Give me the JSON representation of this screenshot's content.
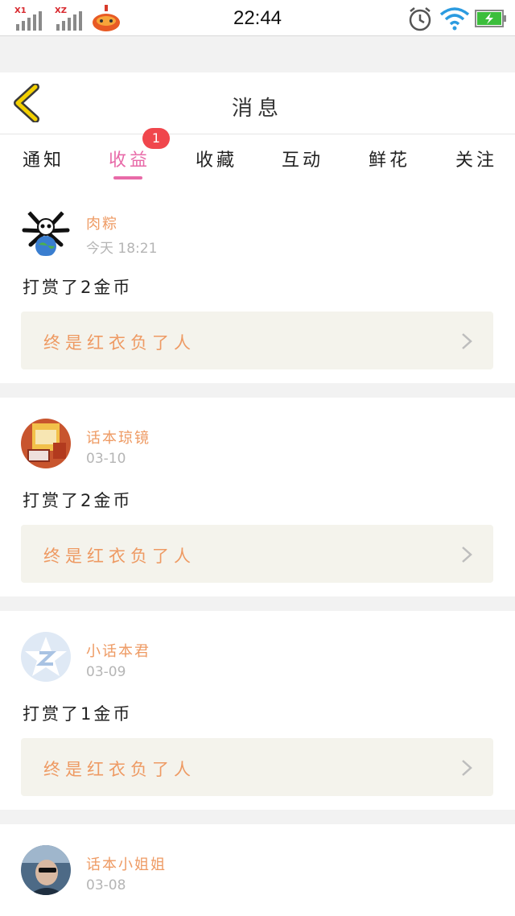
{
  "status_bar": {
    "sim1_label": "X1",
    "sim2_label": "XZ",
    "time": "22:44"
  },
  "nav": {
    "title": "消息",
    "back_icon": "chevron-left-icon",
    "accent": "#f0c800"
  },
  "tabs": {
    "items": [
      {
        "label": "通知"
      },
      {
        "label": "收益",
        "active": true,
        "badge": "1"
      },
      {
        "label": "收藏"
      },
      {
        "label": "互动"
      },
      {
        "label": "鲜花"
      },
      {
        "label": "关注"
      }
    ],
    "active_color": "#e86aa8",
    "badge_color": "#f0464c"
  },
  "feed": [
    {
      "user": "肉粽",
      "time": "今天 18:21",
      "message": "打赏了2金币",
      "work_title": "终是红衣负了人",
      "avatar": "panda-avatar"
    },
    {
      "user": "话本琼镜",
      "time": "03-10",
      "message": "打赏了2金币",
      "work_title": "终是红衣负了人",
      "avatar": "book-avatar"
    },
    {
      "user": "小话本君",
      "time": "03-09",
      "message": "打赏了1金币",
      "work_title": "终是红衣负了人",
      "avatar": "star-z-avatar"
    },
    {
      "user": "话本小姐姐",
      "time": "03-08",
      "message": "",
      "work_title": "",
      "avatar": "photo-avatar"
    }
  ],
  "colors": {
    "name": "#ee9a63",
    "time": "#b5b5b5",
    "work_bg": "#f4f3ec"
  }
}
